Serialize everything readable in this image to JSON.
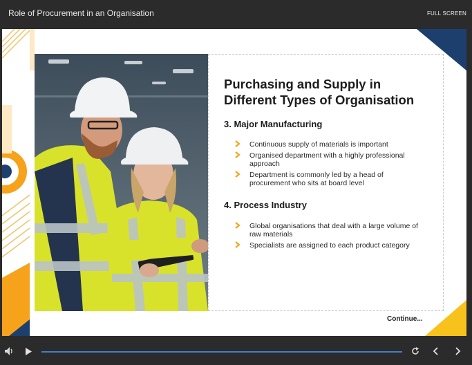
{
  "header": {
    "title": "Role of Procurement in an Organisation",
    "fullscreen_label": "FULL SCREEN"
  },
  "slide": {
    "heading_line1": "Purchasing and Supply in",
    "heading_line2": "Different Types of Organisation",
    "sections": [
      {
        "title": "3. Major Manufacturing",
        "bullets": [
          [
            "Continuous supply of materials is important"
          ],
          [
            "Organised department with a highly professional",
            "approach"
          ],
          [
            "Department is commonly led by a head of",
            "procurement who sits at board level"
          ]
        ]
      },
      {
        "title": "4. Process Industry",
        "bullets": [
          [
            "Global organisations that deal with a large volume of",
            "raw materials"
          ],
          [
            "Specialists are assigned to each product category"
          ]
        ]
      }
    ],
    "continue_label": "Continue..."
  },
  "player": {
    "progress_fraction": 1.0
  },
  "colors": {
    "accent_orange": "#f7a21b",
    "accent_yellow": "#f8c21c",
    "navy": "#1d3f6e",
    "chevron": "#f2a516",
    "progress": "#3f7fc8"
  },
  "icons": {
    "volume": "volume-icon",
    "play": "play-icon",
    "replay": "replay-icon",
    "prev": "chevron-left-icon",
    "next": "chevron-right-icon"
  }
}
